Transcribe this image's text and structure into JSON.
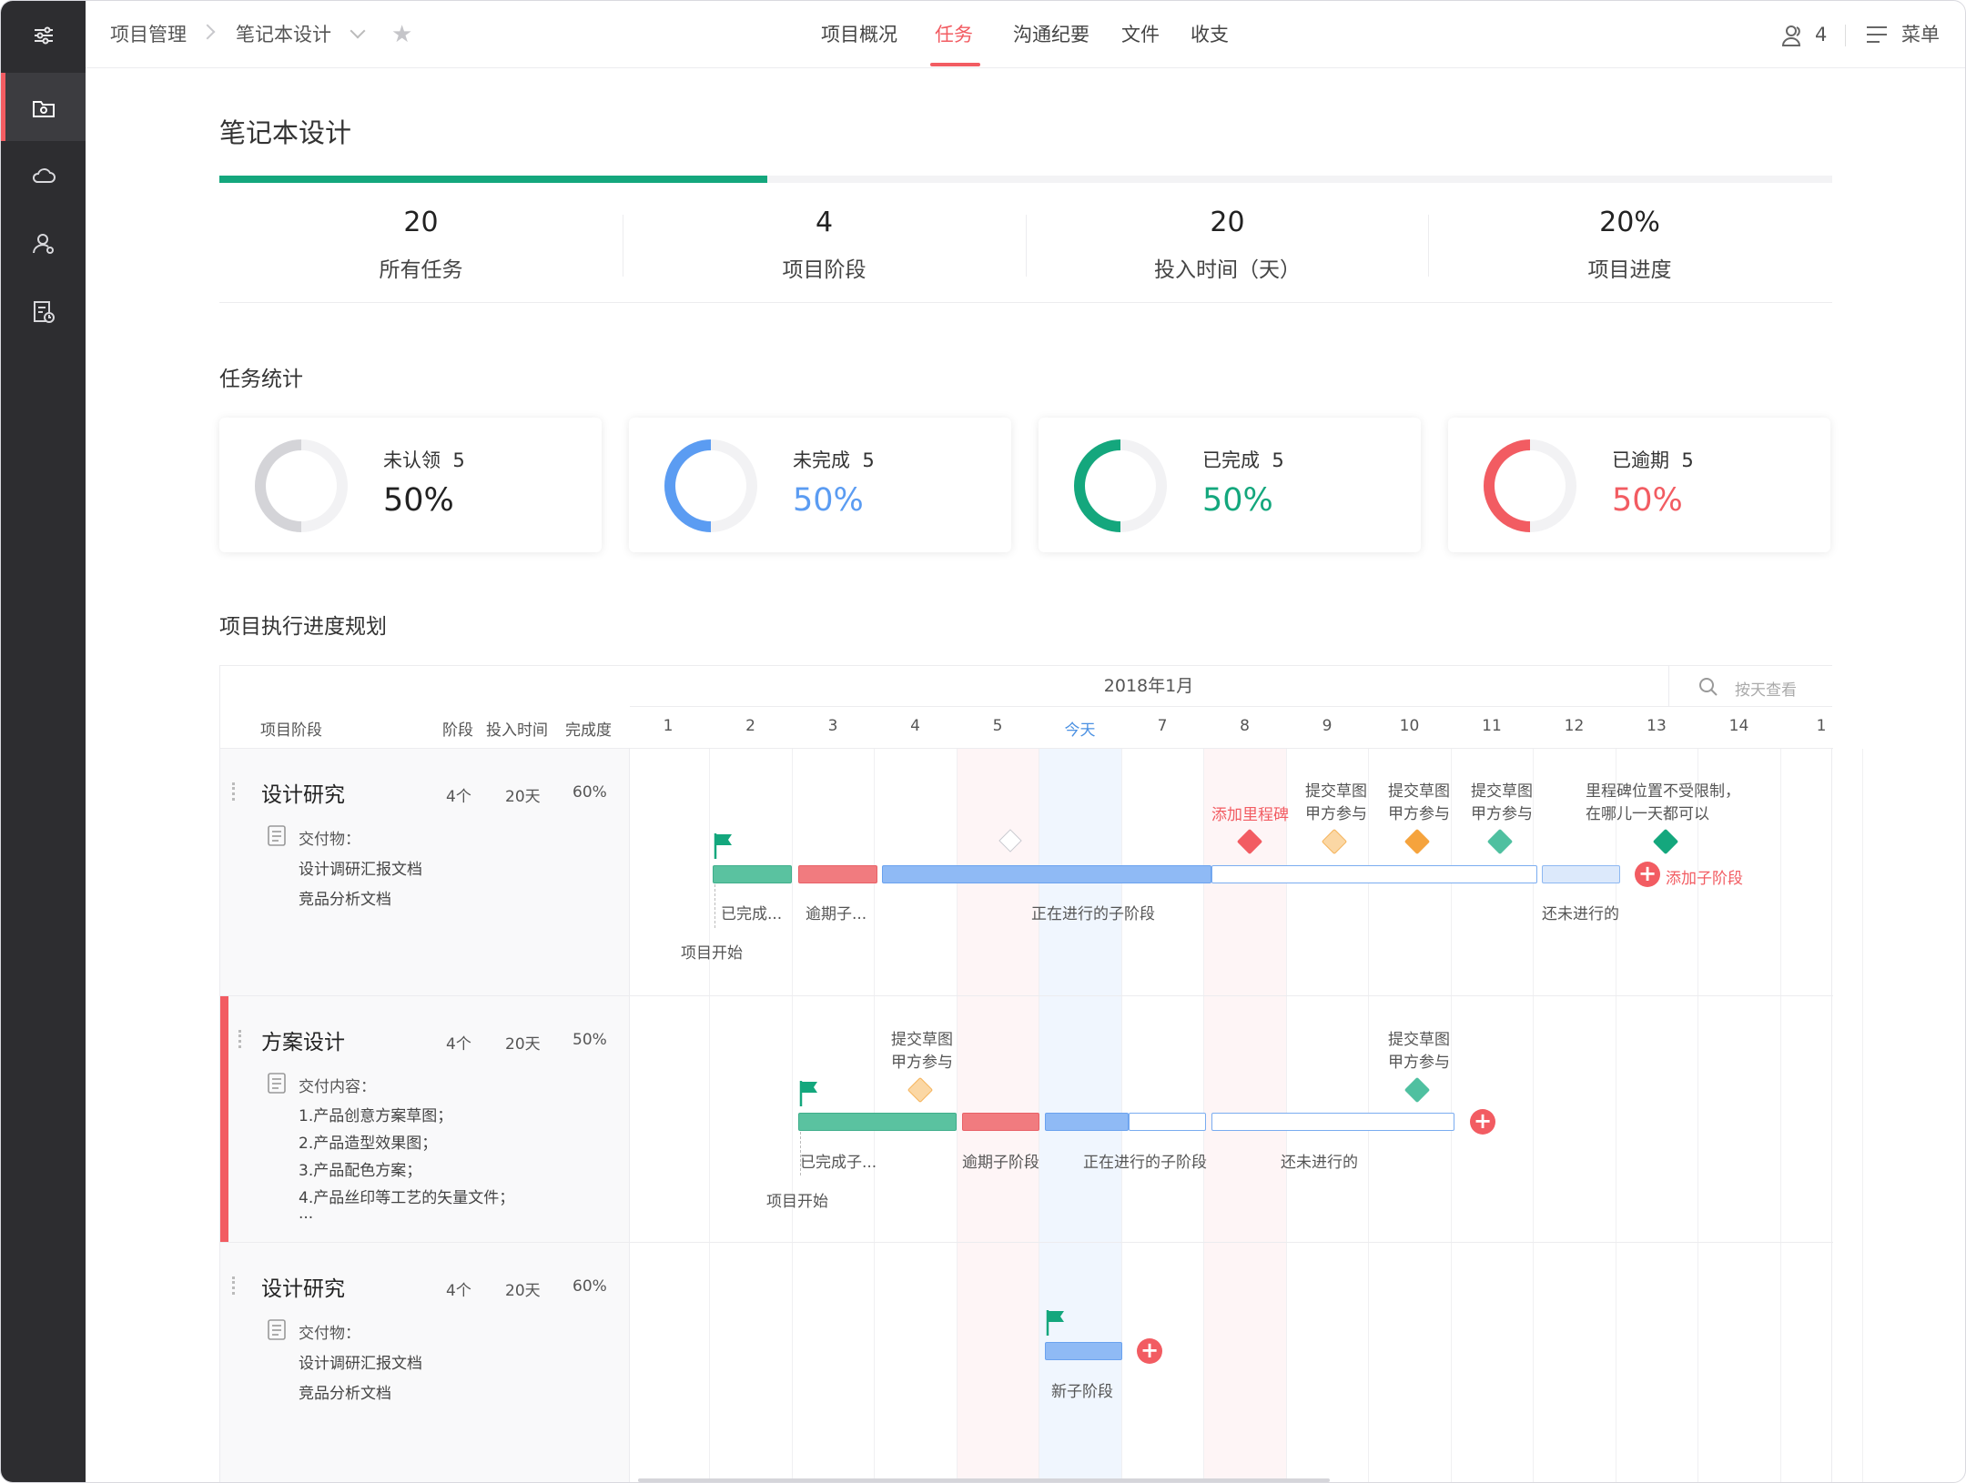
{
  "breadcrumb": {
    "root": "项目管理",
    "current": "笔记本设计"
  },
  "nav_tabs": [
    "项目概况",
    "任务",
    "沟通纪要",
    "文件",
    "收支"
  ],
  "active_tab": "任务",
  "header": {
    "member_count": "4",
    "menu_label": "菜单"
  },
  "project": {
    "title": "笔记本设计",
    "progress_fraction": 0.34
  },
  "stats": [
    {
      "value": "20",
      "label": "所有任务"
    },
    {
      "value": "4",
      "label": "项目阶段"
    },
    {
      "value": "20",
      "label": "投入时间（天）"
    },
    {
      "value": "20%",
      "label": "项目进度"
    }
  ],
  "task_stats": {
    "title": "任务统计",
    "cards": [
      {
        "label": "未认领",
        "count": "5",
        "percent": "50%",
        "color": "#d4d4d8",
        "text_color": "#222222"
      },
      {
        "label": "未完成",
        "count": "5",
        "percent": "50%",
        "color": "#5b9cf2",
        "text_color": "#5b9cf2"
      },
      {
        "label": "已完成",
        "count": "5",
        "percent": "50%",
        "color": "#14a77d",
        "text_color": "#14a77d"
      },
      {
        "label": "已逾期",
        "count": "5",
        "percent": "50%",
        "color": "#f25c62",
        "text_color": "#f25c62"
      }
    ]
  },
  "schedule": {
    "title": "项目执行进度规划",
    "month": "2018年1月",
    "search_placeholder": "按天查看",
    "columns": {
      "phase": "项目阶段",
      "stages": "阶段",
      "time": "投入时间",
      "completion": "完成度"
    },
    "days": [
      "1",
      "2",
      "3",
      "4",
      "5",
      "今天",
      "7",
      "8",
      "9",
      "10",
      "11",
      "12",
      "13",
      "14",
      "1"
    ],
    "phases": [
      {
        "name": "设计研究",
        "stages": "4个",
        "time": "20天",
        "completion": "60%",
        "deliverable_label": "交付物：",
        "deliverables": [
          "设计调研汇报文档",
          "竞品分析文档"
        ],
        "labels": {
          "completed": "已完成...",
          "overdue": "逾期子...",
          "in_progress": "正在进行的子阶段",
          "not_started": "还未进行的",
          "start": "项目开始",
          "add_milestone": "添加里程碑",
          "add_sub": "添加子阶段",
          "ms1_a": "提交草图",
          "ms1_b": "甲方参与",
          "ms2_a": "提交草图",
          "ms2_b": "甲方参与",
          "ms3_a": "提交草图",
          "ms3_b": "甲方参与",
          "note_a": "里程碑位置不受限制，",
          "note_b": "在哪儿一天都可以"
        }
      },
      {
        "name": "方案设计",
        "stages": "4个",
        "time": "20天",
        "completion": "50%",
        "deliverable_label": "交付内容：",
        "deliverables": [
          "1.产品创意方案草图；",
          "2.产品造型效果图；",
          "3.产品配色方案；",
          "4.产品丝印等工艺的矢量文件；",
          "..."
        ],
        "labels": {
          "completed": "已完成子...",
          "overdue": "逾期子阶段",
          "in_progress": "正在进行的子阶段",
          "not_started": "还未进行的",
          "start": "项目开始",
          "ms1_a": "提交草图",
          "ms1_b": "甲方参与",
          "ms2_a": "提交草图",
          "ms2_b": "甲方参与"
        }
      },
      {
        "name": "设计研究",
        "stages": "4个",
        "time": "20天",
        "completion": "60%",
        "deliverable_label": "交付物：",
        "deliverables": [
          "设计调研汇报文档",
          "竞品分析文档"
        ],
        "labels": {
          "new_sub": "新子阶段"
        }
      }
    ]
  },
  "colors": {
    "accent": "#f25c62",
    "green": "#14a77d",
    "blue": "#5b9cf2",
    "sidebar": "#2d2d30"
  }
}
